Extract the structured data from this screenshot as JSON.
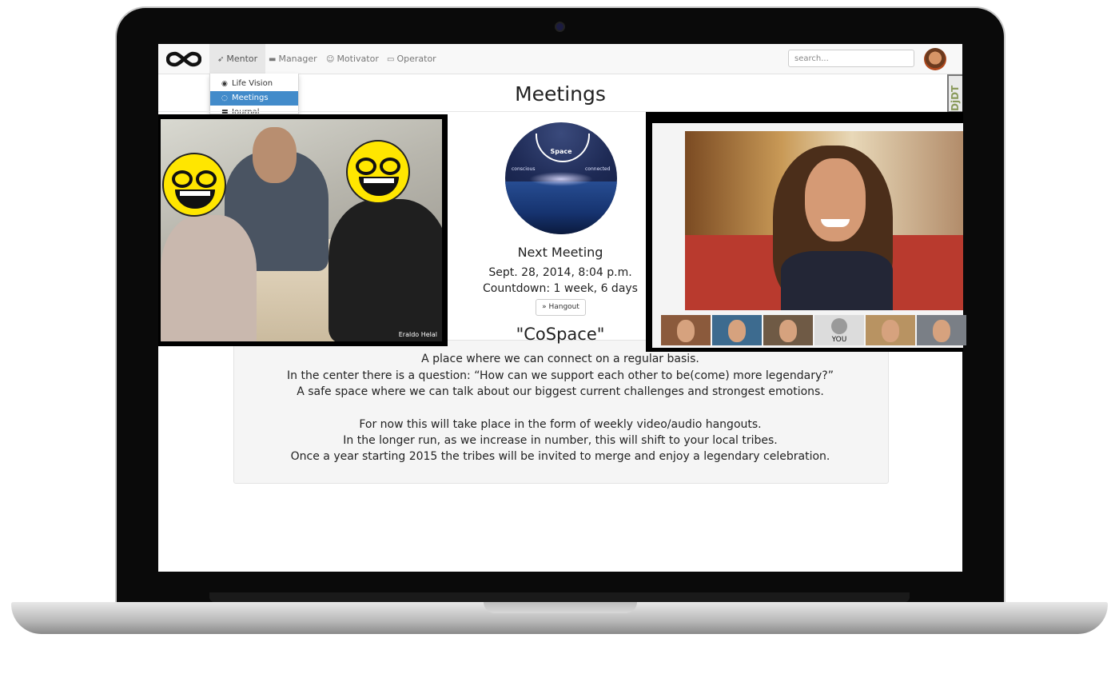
{
  "navbar": {
    "items": [
      {
        "label": "Mentor",
        "icon": "rocket-icon"
      },
      {
        "label": "Manager",
        "icon": "briefcase-icon"
      },
      {
        "label": "Motivator",
        "icon": "smiley-icon"
      },
      {
        "label": "Operator",
        "icon": "monitor-icon"
      }
    ],
    "search_placeholder": "search..."
  },
  "dropdown": {
    "items": [
      {
        "label": "Life Vision",
        "icon": "eye-icon"
      },
      {
        "label": "Meetings",
        "icon": "chat-bubbles-icon"
      },
      {
        "label": "Journal",
        "icon": "book-icon"
      }
    ],
    "selected": "Meetings"
  },
  "page": {
    "title": "Meetings"
  },
  "debug_tab": {
    "label": "DjDT"
  },
  "space_logo": {
    "word": "Space",
    "left_label": "conscious",
    "right_label": "connected"
  },
  "meeting": {
    "next_label": "Next Meeting",
    "date": "Sept. 28, 2014, 8:04 p.m.",
    "countdown": "Countdown: 1 week, 6 days",
    "hangout_button": "» Hangout"
  },
  "cospace": {
    "title": "\"CoSpace\"",
    "lines": [
      "A place where we can connect on a regular basis.",
      "In the center there is a question: “How can we support each other to be(come) more legendary?”",
      "A safe space where we can talk about our biggest current challenges and strongest emotions.",
      "For now this will take place in the form of weekly video/audio hangouts.",
      "In the longer run, as we increase in number, this will shift to your local tribes.",
      "Once a year starting 2015 the tribes will be invited to merge and enjoy a legendary celebration."
    ]
  },
  "photo_left": {
    "credit": "Eraldo Helal"
  },
  "video_call": {
    "you_label": "YOU"
  },
  "colors": {
    "accent": "#428bca",
    "navbar": "#f8f8f8",
    "smiley": "#ffe600"
  }
}
